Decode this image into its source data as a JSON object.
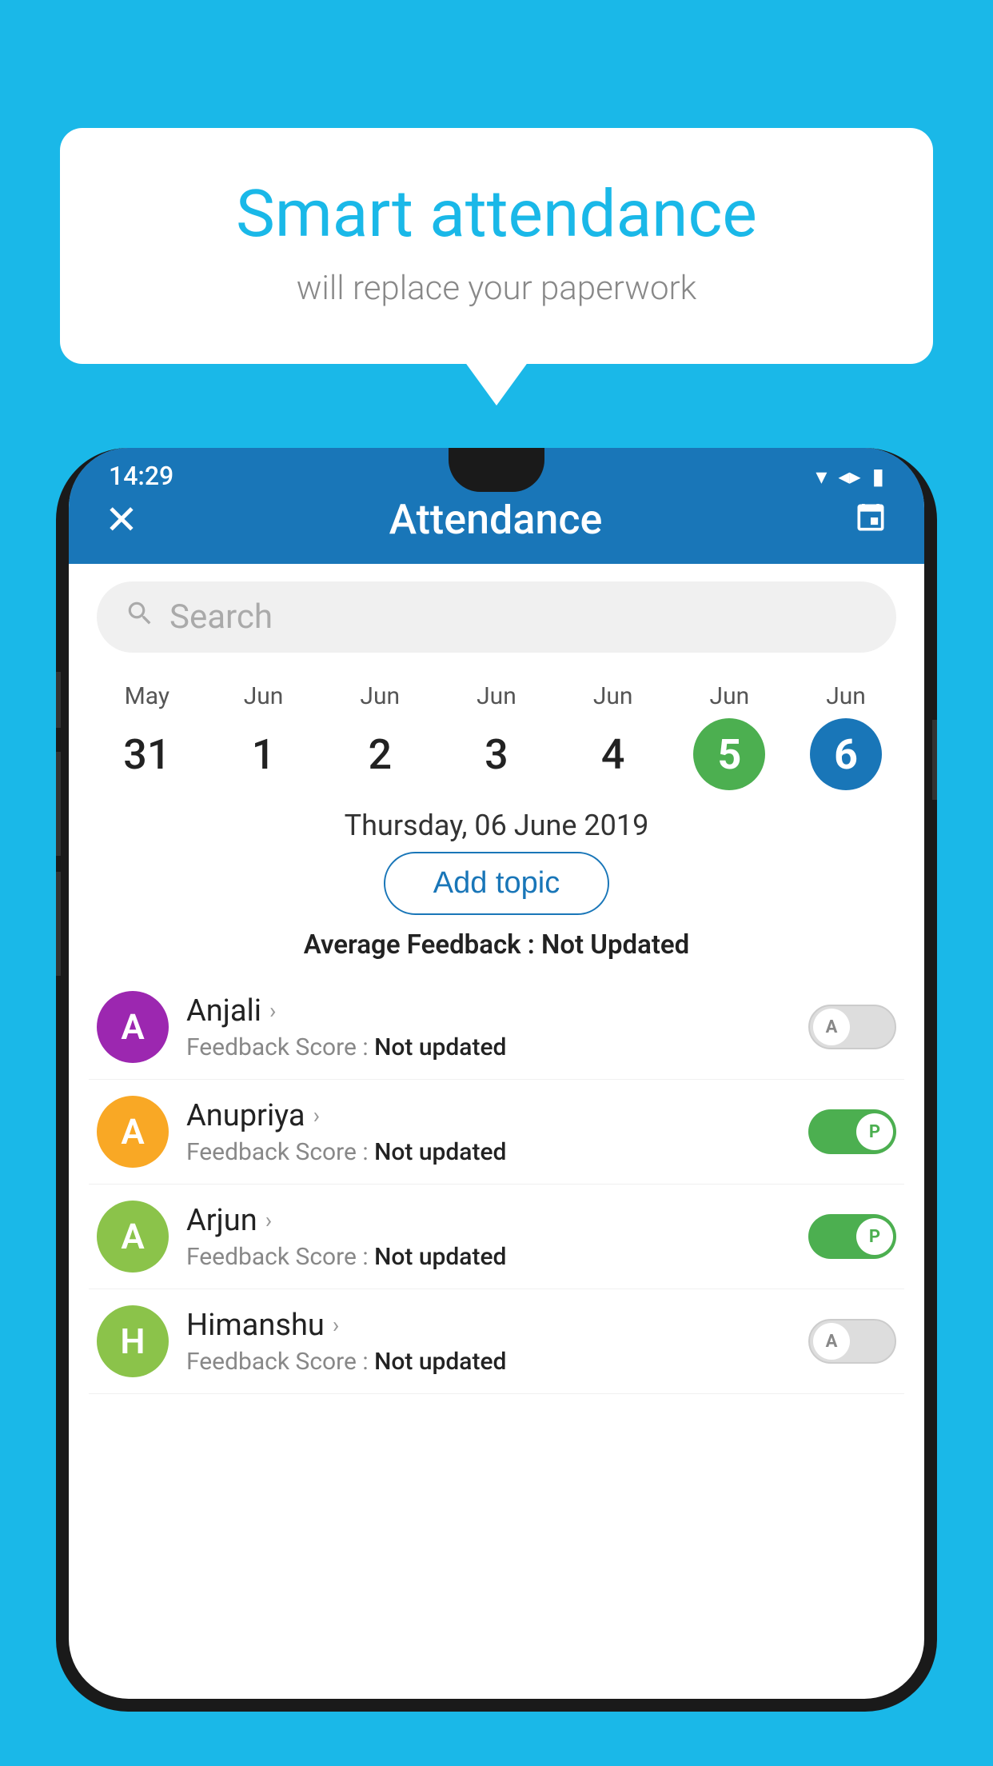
{
  "background_color": "#1ab8e8",
  "speech_bubble": {
    "title": "Smart attendance",
    "subtitle": "will replace your paperwork"
  },
  "status_bar": {
    "time": "14:29",
    "wifi_icon": "▾",
    "signal_icon": "▲",
    "battery_icon": "▮"
  },
  "app_bar": {
    "close_icon": "✕",
    "title": "Attendance",
    "calendar_icon": "📅"
  },
  "search": {
    "placeholder": "Search"
  },
  "calendar": {
    "days": [
      {
        "month": "May",
        "date": "31",
        "state": "normal"
      },
      {
        "month": "Jun",
        "date": "1",
        "state": "normal"
      },
      {
        "month": "Jun",
        "date": "2",
        "state": "normal"
      },
      {
        "month": "Jun",
        "date": "3",
        "state": "normal"
      },
      {
        "month": "Jun",
        "date": "4",
        "state": "normal"
      },
      {
        "month": "Jun",
        "date": "5",
        "state": "today"
      },
      {
        "month": "Jun",
        "date": "6",
        "state": "selected"
      }
    ]
  },
  "selected_date_label": "Thursday, 06 June 2019",
  "add_topic_button": "Add topic",
  "average_feedback": {
    "label": "Average Feedback :",
    "value": "Not Updated"
  },
  "students": [
    {
      "name": "Anjali",
      "avatar_letter": "A",
      "avatar_color": "#9c27b0",
      "feedback_label": "Feedback Score :",
      "feedback_value": "Not updated",
      "toggle_state": "off",
      "toggle_label": "A"
    },
    {
      "name": "Anupriya",
      "avatar_letter": "A",
      "avatar_color": "#f9a825",
      "feedback_label": "Feedback Score :",
      "feedback_value": "Not updated",
      "toggle_state": "on",
      "toggle_label": "P"
    },
    {
      "name": "Arjun",
      "avatar_letter": "A",
      "avatar_color": "#8bc34a",
      "feedback_label": "Feedback Score :",
      "feedback_value": "Not updated",
      "toggle_state": "on",
      "toggle_label": "P"
    },
    {
      "name": "Himanshu",
      "avatar_letter": "H",
      "avatar_color": "#8bc34a",
      "feedback_label": "Feedback Score :",
      "feedback_value": "Not updated",
      "toggle_state": "off",
      "toggle_label": "A"
    }
  ]
}
